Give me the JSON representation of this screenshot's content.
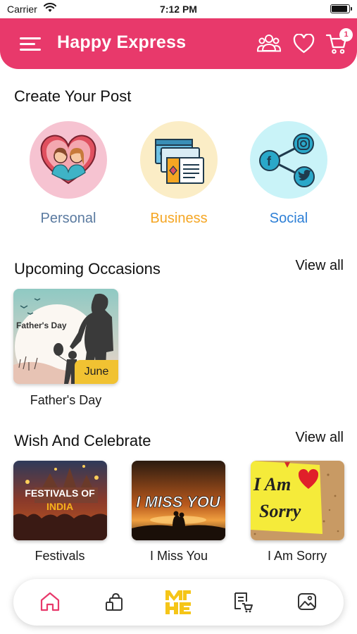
{
  "status_bar": {
    "carrier": "Carrier",
    "time": "7:12 PM",
    "icons": [
      "wifi-icon",
      "battery-icon"
    ]
  },
  "header": {
    "title": "Happy Express",
    "background_color": "#e8396b",
    "cart_count": "1",
    "icons": [
      "menu-icon",
      "group-icon",
      "heart-icon",
      "cart-icon"
    ]
  },
  "create_post": {
    "title": "Create Your Post",
    "types": [
      {
        "label": "Personal",
        "color": "#5a7aa0",
        "circle_color": "#f6c3d1",
        "icon": "couple-heart-icon"
      },
      {
        "label": "Business",
        "color": "#f5a623",
        "circle_color": "#fbedc6",
        "icon": "business-cards-icon"
      },
      {
        "label": "Social",
        "color": "#2d7fd6",
        "circle_color": "#c9f3f8",
        "icon": "social-share-icon"
      }
    ]
  },
  "upcoming_occasions": {
    "title": "Upcoming Occasions",
    "view_all": "View all",
    "items": [
      {
        "image_text": "Father's Day",
        "month": "June",
        "title": "Father's Day"
      }
    ]
  },
  "wish_and_celebrate": {
    "title": "Wish And Celebrate",
    "view_all": "View all",
    "items": [
      {
        "image_text": [
          "FESTIVALS OF",
          "INDIA"
        ],
        "label": "Festivals"
      },
      {
        "image_text": "I MISS YOU",
        "label": "I Miss You"
      },
      {
        "image_text": [
          "I Am",
          "Sorry"
        ],
        "label": "I Am Sorry"
      }
    ]
  },
  "bottom_nav": {
    "items": [
      "home-icon",
      "bag-icon",
      "brand-logo-icon",
      "order-list-icon",
      "gallery-icon"
    ],
    "active": "home-icon",
    "logo_text": "HE",
    "accent_color": "#e8396b",
    "logo_color": "#f5c518"
  }
}
